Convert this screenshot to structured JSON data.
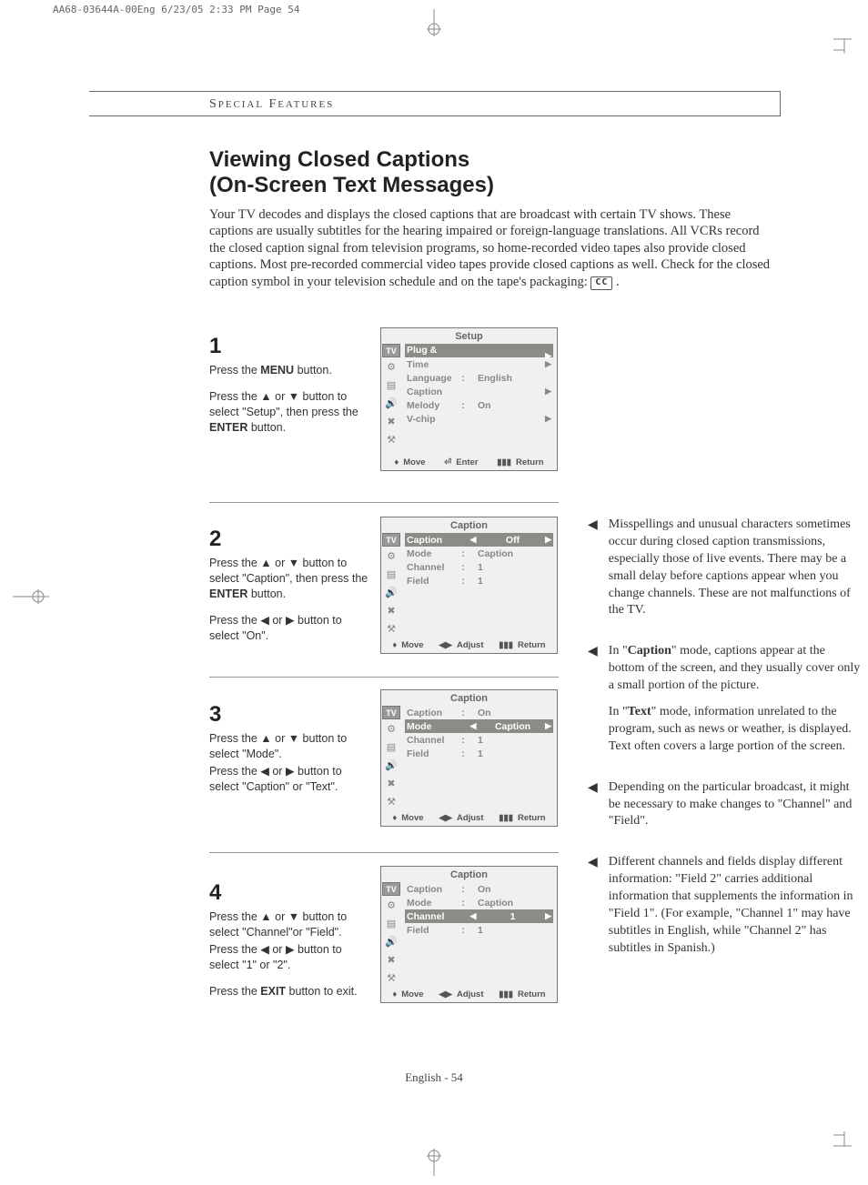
{
  "print_header": "AA68-03644A-00Eng  6/23/05  2:33 PM  Page 54",
  "section_header": "SPECIAL FEATURES",
  "title_line1": "Viewing Closed Captions",
  "title_line2": "(On-Screen Text Messages)",
  "intro": "Your TV decodes and displays the closed captions that are broadcast with certain TV shows. These captions are usually subtitles for the hearing impaired or foreign-language translations. All VCRs record the closed caption signal from television programs, so home-recorded video tapes also provide closed captions. Most pre-recorded commercial video tapes provide closed captions as well. Check for the closed caption symbol in your television schedule and on the tape's packaging:",
  "cc_symbol": "CC",
  "steps": {
    "s1": {
      "num": "1",
      "p1a": "Press the ",
      "p1b": "MENU",
      "p1c": " button.",
      "p2": "Press the ▲ or ▼ button to select \"Setup\", then press the ",
      "p2b": "ENTER",
      "p2c": " button."
    },
    "s2": {
      "num": "2",
      "p1": "Press the ▲ or ▼ button to select \"Caption\", then press the ",
      "p1b": "ENTER",
      "p1c": " button.",
      "p2": "Press the ◀ or ▶ button to select \"On\"."
    },
    "s3": {
      "num": "3",
      "p1": "Press the ▲ or ▼ button to select \"Mode\".",
      "p2": "Press the ◀ or ▶ button to select \"Caption\" or \"Text\"."
    },
    "s4": {
      "num": "4",
      "p1": "Press the ▲ or ▼ button to select \"Channel\"or \"Field\".",
      "p2": "Press the ◀ or ▶ button to select \"1\" or \"2\".",
      "p3a": "Press the ",
      "p3b": "EXIT",
      "p3c": " button to exit."
    }
  },
  "osd": {
    "screen1": {
      "title": "Setup",
      "rows": [
        {
          "label": "Plug & Play",
          "col2": "",
          "val": "",
          "tri": "▶",
          "hl": true
        },
        {
          "label": "Time",
          "col2": "",
          "val": "",
          "tri": "▶",
          "hl": false
        },
        {
          "label": "Language",
          "col2": ":",
          "val": "English",
          "tri": "",
          "hl": false
        },
        {
          "label": "Caption",
          "col2": "",
          "val": "",
          "tri": "▶",
          "hl": false
        },
        {
          "label": "Melody",
          "col2": ":",
          "val": "On",
          "tri": "",
          "hl": false
        },
        {
          "label": "V-chip",
          "col2": "",
          "val": "",
          "tri": "▶",
          "hl": false
        }
      ],
      "footer": {
        "a": "Move",
        "b": "Enter",
        "c": "Return"
      }
    },
    "screen2": {
      "title": "Caption",
      "rows": [
        {
          "label": "Caption",
          "tril": "◀",
          "val": "Off",
          "tri": "▶",
          "hl": true,
          "wide": true
        },
        {
          "label": "Mode",
          "col2": ":",
          "val": "Caption",
          "tri": "",
          "hl": false
        },
        {
          "label": "Channel",
          "col2": ":",
          "val": "1",
          "tri": "",
          "hl": false
        },
        {
          "label": "Field",
          "col2": ":",
          "val": "1",
          "tri": "",
          "hl": false
        }
      ],
      "footer": {
        "a": "Move",
        "b": "Adjust",
        "c": "Return"
      }
    },
    "screen3": {
      "title": "Caption",
      "rows": [
        {
          "label": "Caption",
          "col2": ":",
          "val": "On",
          "tri": "",
          "hl": false
        },
        {
          "label": "Mode",
          "tril": "◀",
          "val": "Caption",
          "tri": "▶",
          "hl": true,
          "wide": true
        },
        {
          "label": "Channel",
          "col2": ":",
          "val": "1",
          "tri": "",
          "hl": false
        },
        {
          "label": "Field",
          "col2": ":",
          "val": "1",
          "tri": "",
          "hl": false
        }
      ],
      "footer": {
        "a": "Move",
        "b": "Adjust",
        "c": "Return"
      }
    },
    "screen4": {
      "title": "Caption",
      "rows": [
        {
          "label": "Caption",
          "col2": ":",
          "val": "On",
          "tri": "",
          "hl": false
        },
        {
          "label": "Mode",
          "col2": ":",
          "val": "Caption",
          "tri": "",
          "hl": false
        },
        {
          "label": "Channel",
          "tril": "◀",
          "val": "1",
          "tri": "▶",
          "hl": true,
          "wide": true
        },
        {
          "label": "Field",
          "col2": ":",
          "val": "1",
          "tri": "",
          "hl": false
        }
      ],
      "footer": {
        "a": "Move",
        "b": "Adjust",
        "c": "Return"
      }
    }
  },
  "notes": {
    "n1": "Misspellings and unusual characters sometimes occur during closed caption transmissions, especially those of live events. There may be a small delay before captions appear when you change channels. These are not malfunctions of the TV.",
    "n2a": "In \"",
    "n2b": "Caption",
    "n2c": "\" mode, captions appear at the bottom of the screen, and they usually cover only a small portion of the picture.",
    "n2d": "In \"",
    "n2e": "Text",
    "n2f": "\" mode, information unrelated to the program, such as news or weather, is displayed. Text often covers a large portion of the screen.",
    "n3": "Depending on the particular broadcast, it might be necessary to make changes to \"Channel\" and \"Field\".",
    "n4": "Different channels and fields display different information: \"Field 2\" carries additional information that supplements the information in \"Field 1\". (For example, \"Channel 1\" may have subtitles in English, while \"Channel 2\" has subtitles in Spanish.)"
  },
  "page_footer": "English - 54",
  "tab_icons": [
    "TV",
    "⚙",
    "▤",
    "🔊",
    "✖",
    "⚒"
  ]
}
